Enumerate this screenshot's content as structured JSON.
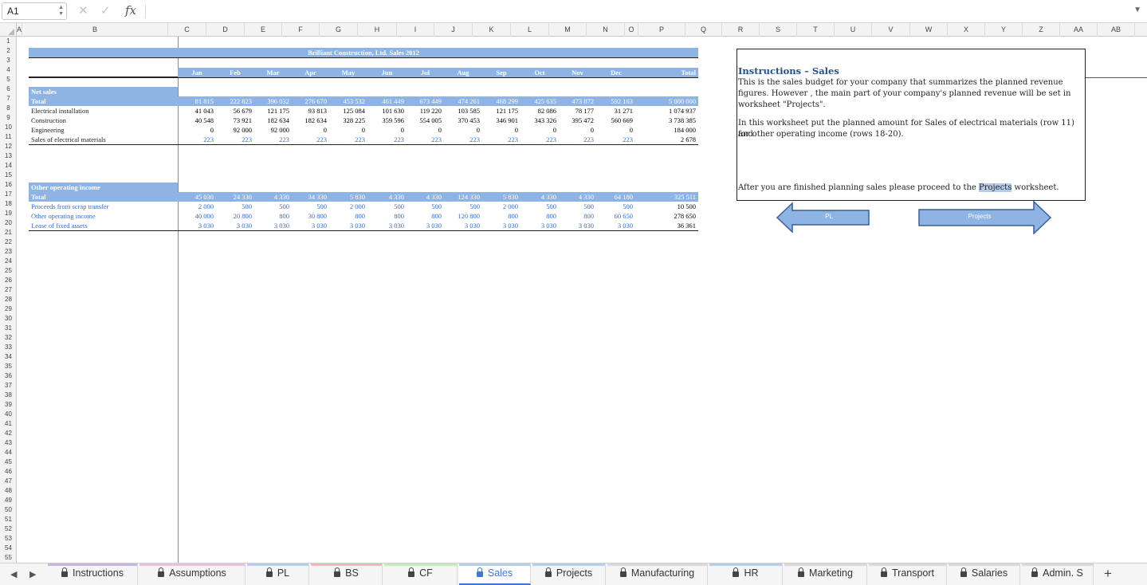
{
  "formula_bar": {
    "cell_ref": "A1",
    "fx": "fx",
    "cancel": "✕",
    "confirm": "✓",
    "value": "",
    "expand": "▼"
  },
  "columns": [
    "A",
    "B",
    "C",
    "D",
    "E",
    "F",
    "G",
    "H",
    "I",
    "J",
    "K",
    "L",
    "M",
    "N",
    "O",
    "P",
    "Q",
    "R",
    "S",
    "T",
    "U",
    "V",
    "W",
    "X",
    "Y",
    "Z",
    "AA",
    "AB"
  ],
  "rows": [
    "1",
    "2",
    "3",
    "4",
    "5",
    "6",
    "7",
    "8",
    "9",
    "10",
    "11",
    "12",
    "13",
    "14",
    "15",
    "16",
    "17",
    "18",
    "19",
    "20",
    "21",
    "22",
    "23",
    "24",
    "25",
    "26",
    "27",
    "28",
    "29",
    "30",
    "31",
    "32",
    "33",
    "34",
    "35",
    "36",
    "37",
    "38",
    "39",
    "40",
    "41",
    "42",
    "43",
    "44",
    "45",
    "46",
    "47",
    "48",
    "49",
    "50",
    "51",
    "52",
    "53",
    "54",
    "55"
  ],
  "sheet": {
    "title": "Brilliant Construction, Ltd. Sales 2012",
    "months": [
      "Jan",
      "Feb",
      "Mar",
      "Apr",
      "May",
      "Jun",
      "Jul",
      "Aug",
      "Sep",
      "Oct",
      "Nov",
      "Dec",
      "Total"
    ],
    "net_sales": {
      "header": "Net sales",
      "rows": [
        {
          "label": "Total",
          "values": [
            "81 815",
            "222 823",
            "396 032",
            "276 670",
            "453 532",
            "461 449",
            "673 449",
            "474 261",
            "468 299",
            "425 635",
            "473 872",
            "592 163",
            "5 000 000"
          ]
        },
        {
          "label": "Electrical installation",
          "values": [
            "41 043",
            "56 679",
            "121 175",
            "93 813",
            "125 084",
            "101 630",
            "119 220",
            "103 585",
            "121 175",
            "82 086",
            "78 177",
            "31 271",
            "1 074 937"
          ]
        },
        {
          "label": "Construction",
          "values": [
            "40 548",
            "73 921",
            "182 634",
            "182 634",
            "328 225",
            "359 596",
            "554 005",
            "370 453",
            "346 901",
            "343 326",
            "395 472",
            "560 669",
            "3 738 385"
          ]
        },
        {
          "label": "Engineering",
          "values": [
            "0",
            "92 000",
            "92 000",
            "0",
            "0",
            "0",
            "0",
            "0",
            "0",
            "0",
            "0",
            "0",
            "184 000"
          ]
        },
        {
          "label": "Sales of electrical materials",
          "values": [
            "223",
            "223",
            "223",
            "223",
            "223",
            "223",
            "223",
            "223",
            "223",
            "223",
            "223",
            "223",
            "2 678"
          ]
        }
      ]
    },
    "other_income": {
      "header": "Other operating income",
      "rows": [
        {
          "label": "Total",
          "values": [
            "45 030",
            "24 330",
            "4 330",
            "34 330",
            "5 830",
            "4 330",
            "4 330",
            "124 330",
            "5 830",
            "4 330",
            "4 330",
            "64 180",
            "325 511"
          ]
        },
        {
          "label": "Proceeds from scrap transfer",
          "values": [
            "2 000",
            "500",
            "500",
            "500",
            "2 000",
            "500",
            "500",
            "500",
            "2 000",
            "500",
            "500",
            "500",
            "10 500"
          ]
        },
        {
          "label": "Other operating income",
          "values": [
            "40 000",
            "20 800",
            "800",
            "30 800",
            "800",
            "800",
            "800",
            "120 800",
            "800",
            "800",
            "800",
            "60 650",
            "278 650"
          ]
        },
        {
          "label": "Lease of fixed assets",
          "values": [
            "3 030",
            "3 030",
            "3 030",
            "3 030",
            "3 030",
            "3 030",
            "3 030",
            "3 030",
            "3 030",
            "3 030",
            "3 030",
            "3 030",
            "36 361"
          ]
        }
      ]
    }
  },
  "instructions": {
    "title": "Instructions – Sales",
    "p1_line1": "This is the sales budget for your company that summarizes the planned revenue",
    "p1_line2": "figures. However , the main part of your company's planned revenue will be set in",
    "p1_line3": "worksheet \"Projects\".",
    "p2_line1": "In this worksheet put the planned amount for Sales of electrical materials (row 11) and",
    "p2_line2": "for other operating income (rows 18-20).",
    "p3_before": "After you are finished planning sales please proceed to the ",
    "p3_highlight": "Projects",
    "p3_after": " worksheet."
  },
  "buttons": {
    "pl": "PL",
    "projects": "Projects"
  },
  "tabs": [
    {
      "label": "Instructions",
      "color": "#c9b6e0"
    },
    {
      "label": "Assumptions",
      "color": "#e6c3d8"
    },
    {
      "label": "PL",
      "color": "#b9cde9"
    },
    {
      "label": "BS",
      "color": "#f0b8b8"
    },
    {
      "label": "CF",
      "color": "#c8e6c0"
    },
    {
      "label": "Sales",
      "color": "#b9cde9"
    },
    {
      "label": "Projects",
      "color": "#b9cde9"
    },
    {
      "label": "Manufacturing",
      "color": "#d8d8d8"
    },
    {
      "label": "HR",
      "color": "#b9cde9"
    },
    {
      "label": "Marketing",
      "color": "#d8d8d8"
    },
    {
      "label": "Transport",
      "color": "#d8d8d8"
    },
    {
      "label": "Salaries",
      "color": "#d8d8d8"
    },
    {
      "label": "Admin. S",
      "color": "#d8d8d8"
    }
  ],
  "active_tab": "Sales",
  "add_tab": "+"
}
